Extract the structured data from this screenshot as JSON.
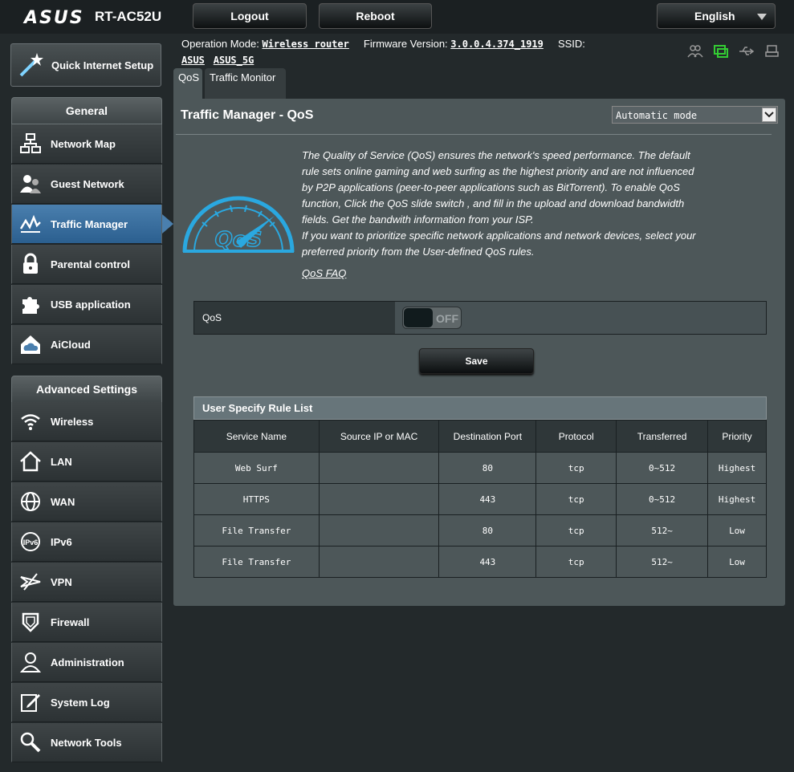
{
  "header": {
    "brand": "ASUS",
    "model": "RT-AC52U",
    "logout": "Logout",
    "reboot": "Reboot",
    "language": "English"
  },
  "info": {
    "op_mode_label": "Operation Mode:",
    "op_mode_value": "Wireless router",
    "fw_label": "Firmware Version:",
    "fw_value": "3.0.0.4.374_1919",
    "ssid_label": "SSID:",
    "ssid_1": "ASUS",
    "ssid_2": "ASUS_5G"
  },
  "sidebar": {
    "qis": "Quick Internet Setup",
    "general_title": "General",
    "general": [
      {
        "label": "Network Map",
        "icon": "network-map-icon"
      },
      {
        "label": "Guest Network",
        "icon": "guest-network-icon"
      },
      {
        "label": "Traffic Manager",
        "icon": "traffic-manager-icon"
      },
      {
        "label": "Parental control",
        "icon": "lock-icon"
      },
      {
        "label": "USB application",
        "icon": "puzzle-icon"
      },
      {
        "label": "AiCloud",
        "icon": "cloud-icon"
      }
    ],
    "advanced_title": "Advanced Settings",
    "advanced": [
      {
        "label": "Wireless",
        "icon": "wifi-icon"
      },
      {
        "label": "LAN",
        "icon": "home-icon"
      },
      {
        "label": "WAN",
        "icon": "globe-icon"
      },
      {
        "label": "IPv6",
        "icon": "ipv6-icon"
      },
      {
        "label": "VPN",
        "icon": "vpn-icon"
      },
      {
        "label": "Firewall",
        "icon": "shield-icon"
      },
      {
        "label": "Administration",
        "icon": "user-icon"
      },
      {
        "label": "System Log",
        "icon": "log-icon"
      },
      {
        "label": "Network Tools",
        "icon": "tools-icon"
      }
    ]
  },
  "tabs": [
    "QoS",
    "Traffic Monitor"
  ],
  "main": {
    "title": "Traffic Manager - QoS",
    "mode": "Automatic mode",
    "description": "The Quality of Service (QoS) ensures the network's speed performance. The default rule sets online gaming and web surfing as the highest priority and are not influenced by P2P applications (peer-to-peer applications such as BitTorrent). To enable QoS function, Click the QoS slide switch , and fill in the upload and download bandwidth fields. Get the bandwith information from your ISP.",
    "description2": "If you want to prioritize specific network applications and network devices, select your preferred priority from the User-defined QoS rules.",
    "faq": "QoS FAQ",
    "logo_text": "QoS",
    "qos_label": "QoS",
    "toggle_state": "OFF",
    "save": "Save"
  },
  "rules": {
    "title": "User Specify Rule List",
    "columns": [
      "Service Name",
      "Source IP or MAC",
      "Destination Port",
      "Protocol",
      "Transferred",
      "Priority"
    ],
    "rows": [
      [
        "Web Surf",
        "",
        "80",
        "tcp",
        "0~512",
        "Highest"
      ],
      [
        "HTTPS",
        "",
        "443",
        "tcp",
        "0~512",
        "Highest"
      ],
      [
        "File Transfer",
        "",
        "80",
        "tcp",
        "512~",
        "Low"
      ],
      [
        "File Transfer",
        "",
        "443",
        "tcp",
        "512~",
        "Low"
      ]
    ]
  },
  "colors": {
    "accent": "#4a7fae",
    "panel": "#4d5759",
    "background": "#23292b",
    "status_active": "#33cc33",
    "logo_blue": "#2aa8e0"
  }
}
